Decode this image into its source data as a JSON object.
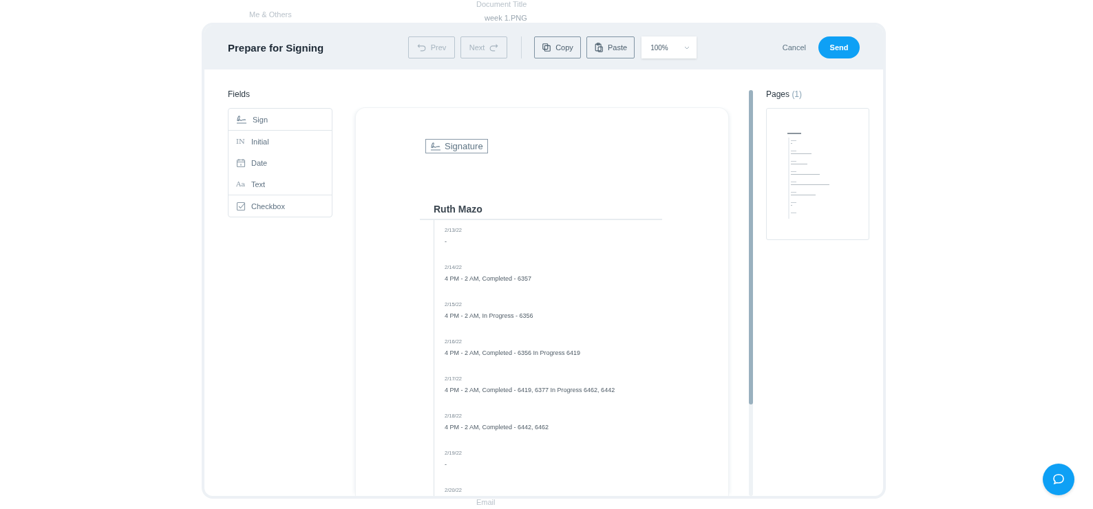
{
  "background": {
    "sharing_option": "Me & Others",
    "document_title_label": "Document Title",
    "document_file": "week 1.PNG",
    "email_label": "Email"
  },
  "modal": {
    "title": "Prepare for Signing",
    "toolbar": [
      {
        "label": "Prev",
        "kind": "prev",
        "disabled": true
      },
      {
        "label": "Next",
        "kind": "next",
        "disabled": true
      },
      {
        "label": "Copy",
        "kind": "copy",
        "disabled": false
      },
      {
        "label": "Paste",
        "kind": "paste",
        "disabled": false
      }
    ],
    "zoom": "100%",
    "cancel": "Cancel",
    "send": "Send"
  },
  "fields": {
    "title": "Fields",
    "groups": [
      [
        {
          "label": "Sign",
          "kind": "sign"
        }
      ],
      [
        {
          "label": "Initial",
          "kind": "initial",
          "glyph": "IN"
        },
        {
          "label": "Date",
          "kind": "date"
        },
        {
          "label": "Text",
          "kind": "text",
          "glyph": "Aa"
        }
      ],
      [
        {
          "label": "Checkbox",
          "kind": "checkbox"
        }
      ]
    ]
  },
  "document": {
    "signature_label": "Signature",
    "name": "Ruth Mazo",
    "entries": [
      {
        "date": "2/13/22",
        "text": "-"
      },
      {
        "date": "2/14/22",
        "text": "4 PM - 2 AM, Completed - 6357"
      },
      {
        "date": "2/15/22",
        "text": "4 PM - 2 AM, In Progress - 6356"
      },
      {
        "date": "2/16/22",
        "text": "4 PM - 2 AM, Completed - 6356 In Progress 6419"
      },
      {
        "date": "2/17/22",
        "text": "4 PM - 2 AM, Completed - 6419, 6377 In Progress 6462, 6442"
      },
      {
        "date": "2/18/22",
        "text": "4 PM - 2 AM, Completed - 6442, 6462"
      },
      {
        "date": "2/19/22",
        "text": "-"
      },
      {
        "date": "2/20/22"
      }
    ]
  },
  "pages": {
    "title": "Pages",
    "count": "(1)"
  }
}
